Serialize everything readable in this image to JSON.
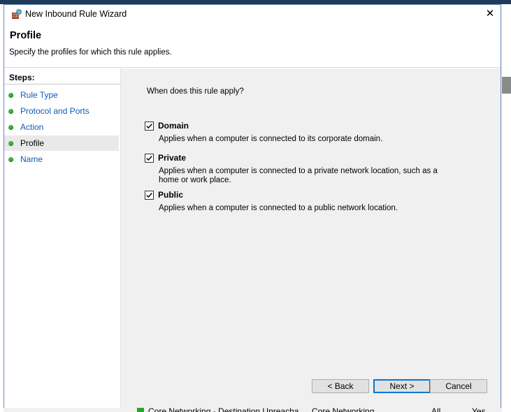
{
  "window": {
    "title": "New Inbound Rule Wizard",
    "close_glyph": "✕"
  },
  "header": {
    "title": "Profile",
    "subtitle": "Specify the profiles for which this rule applies."
  },
  "steps": {
    "title": "Steps:",
    "items": [
      {
        "label": "Rule Type",
        "active": false
      },
      {
        "label": "Protocol and Ports",
        "active": false
      },
      {
        "label": "Action",
        "active": false
      },
      {
        "label": "Profile",
        "active": true
      },
      {
        "label": "Name",
        "active": false
      }
    ]
  },
  "content": {
    "question": "When does this rule apply?",
    "options": [
      {
        "label": "Domain",
        "checked": true,
        "description": "Applies when a computer is connected to its corporate domain."
      },
      {
        "label": "Private",
        "checked": true,
        "description": "Applies when a computer is connected to a private network location, such as a home or work place."
      },
      {
        "label": "Public",
        "checked": true,
        "description": "Applies when a computer is connected to a public network location."
      }
    ]
  },
  "buttons": {
    "back": "< Back",
    "next": "Next >",
    "cancel": "Cancel"
  },
  "background": {
    "row": {
      "name": "Core Networking - Destination Unreacha...",
      "group": "Core Networking",
      "profile": "All",
      "enabled": "Yes"
    }
  },
  "colors": {
    "link": "#0d5bb8",
    "step_dot": "#3ab83a",
    "default_button_border": "#0078d7"
  }
}
